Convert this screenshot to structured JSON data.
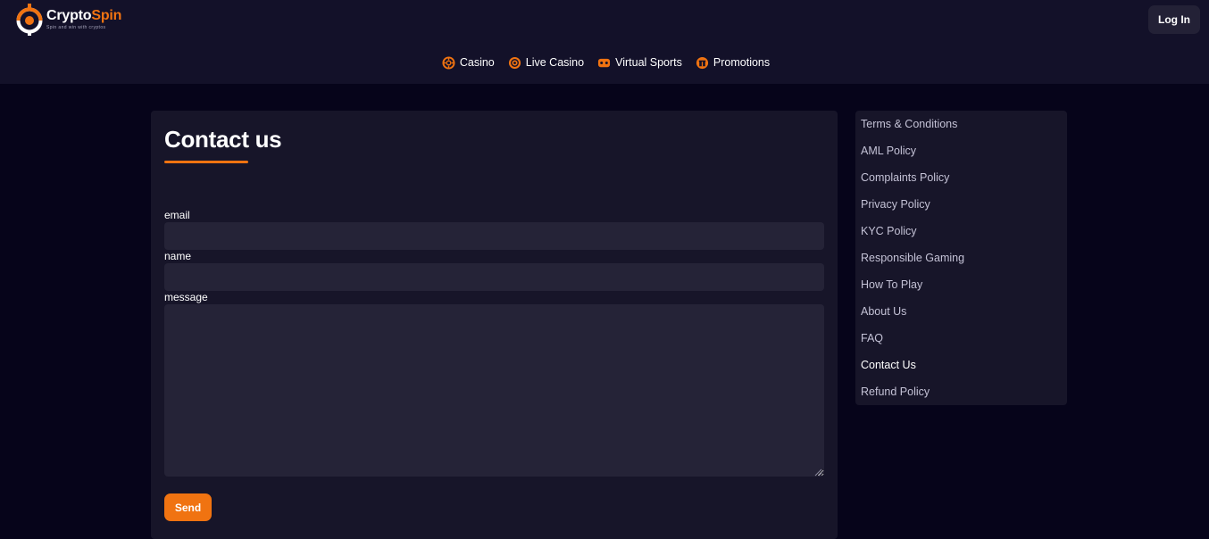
{
  "brand": {
    "name_part1": "Crypto",
    "name_part2": "Spin",
    "tagline": "Spin and win with cryptos",
    "accent_color": "#f07311"
  },
  "header": {
    "login_label": "Log In"
  },
  "nav": {
    "items": [
      {
        "label": "Casino",
        "icon": "casino-chip-icon"
      },
      {
        "label": "Live Casino",
        "icon": "live-casino-icon"
      },
      {
        "label": "Virtual Sports",
        "icon": "virtual-sports-icon"
      },
      {
        "label": "Promotions",
        "icon": "gift-icon"
      }
    ]
  },
  "contact": {
    "title": "Contact us",
    "fields": {
      "email_label": "email",
      "email_value": "",
      "name_label": "name",
      "name_value": "",
      "message_label": "message",
      "message_value": ""
    },
    "send_label": "Send"
  },
  "sidebar": {
    "items": [
      {
        "label": "Terms & Conditions",
        "active": false
      },
      {
        "label": "AML Policy",
        "active": false
      },
      {
        "label": "Complaints Policy",
        "active": false
      },
      {
        "label": "Privacy Policy",
        "active": false
      },
      {
        "label": "KYC Policy",
        "active": false
      },
      {
        "label": "Responsible Gaming",
        "active": false
      },
      {
        "label": "How To Play",
        "active": false
      },
      {
        "label": "About Us",
        "active": false
      },
      {
        "label": "FAQ",
        "active": false
      },
      {
        "label": "Contact Us",
        "active": true
      },
      {
        "label": "Refund Policy",
        "active": false
      }
    ]
  },
  "colors": {
    "background": "#06041a",
    "header_bg": "#131129",
    "card_bg": "#171529",
    "input_bg": "#252337"
  }
}
